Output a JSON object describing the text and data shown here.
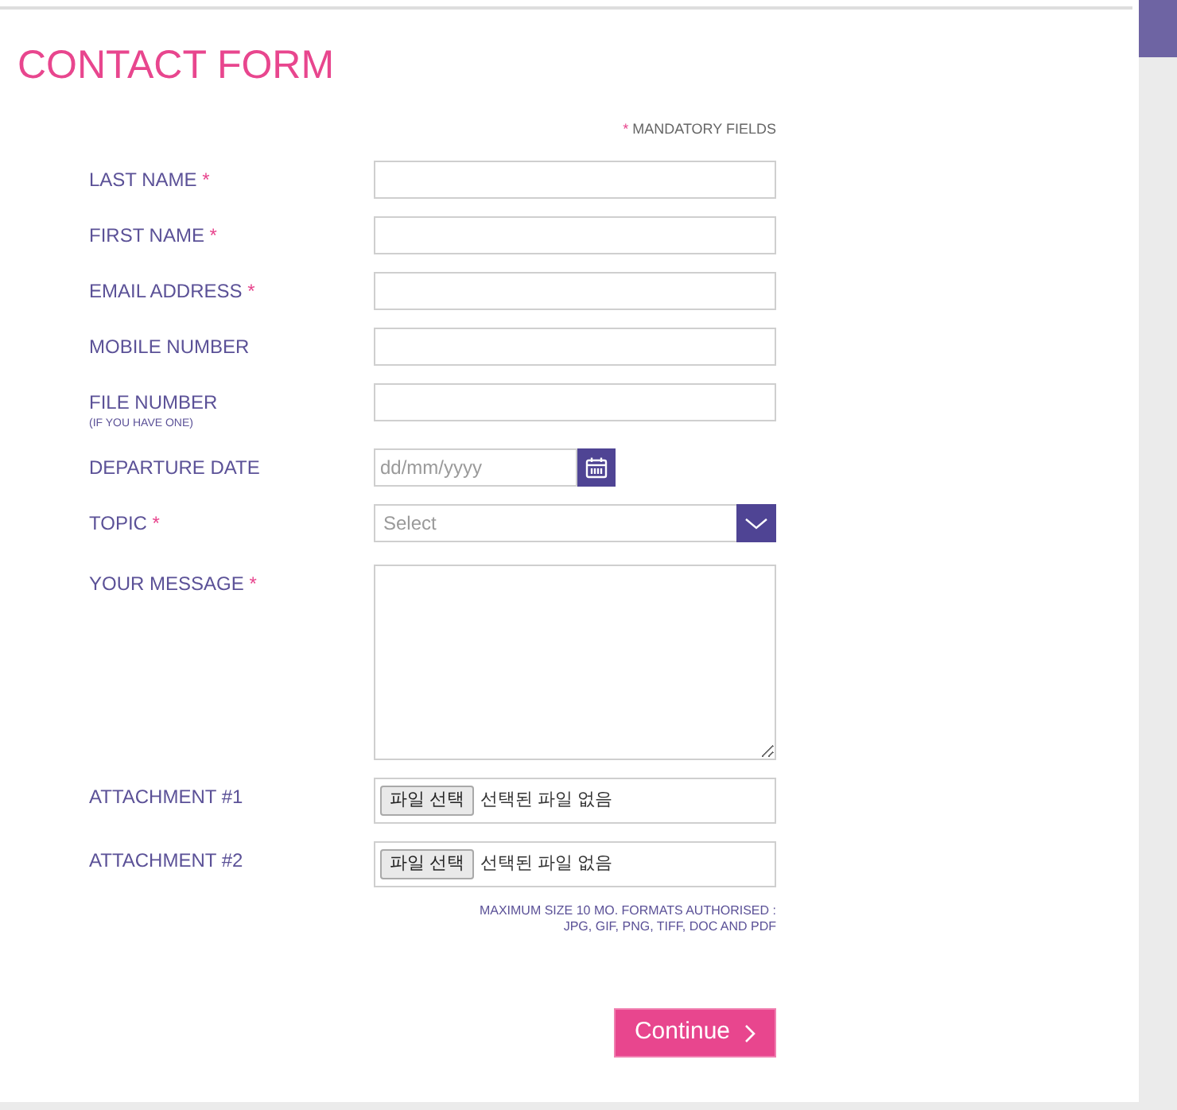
{
  "title": "CONTACT FORM",
  "mandatory_note": {
    "mark": "*",
    "text": "MANDATORY FIELDS"
  },
  "fields": [
    {
      "kind": "text",
      "label": "LAST NAME",
      "required_mark": "*"
    },
    {
      "kind": "text",
      "label": "FIRST NAME",
      "required_mark": "*"
    },
    {
      "kind": "text",
      "label": "EMAIL ADDRESS",
      "required_mark": "*"
    },
    {
      "kind": "text",
      "label": "MOBILE NUMBER"
    },
    {
      "kind": "text",
      "label": "FILE NUMBER",
      "hint": "(IF YOU HAVE ONE)"
    },
    {
      "kind": "date",
      "label": "DEPARTURE DATE",
      "placeholder": "dd/mm/yyyy"
    },
    {
      "kind": "select",
      "label": "TOPIC",
      "required_mark": "*",
      "placeholder": "Select"
    },
    {
      "kind": "textarea",
      "label": "YOUR MESSAGE",
      "required_mark": "*"
    },
    {
      "kind": "file",
      "label": "ATTACHMENT #1",
      "button": "파일 선택",
      "status": "선택된 파일 없음"
    },
    {
      "kind": "file",
      "label": "ATTACHMENT #2",
      "button": "파일 선택",
      "status": "선택된 파일 없음"
    }
  ],
  "file_note": [
    "MAXIMUM SIZE 10 MO. FORMATS AUTHORISED :",
    "JPG, GIF, PNG, TIFF, DOC AND PDF"
  ],
  "continue_button": {
    "label": "Continue"
  }
}
